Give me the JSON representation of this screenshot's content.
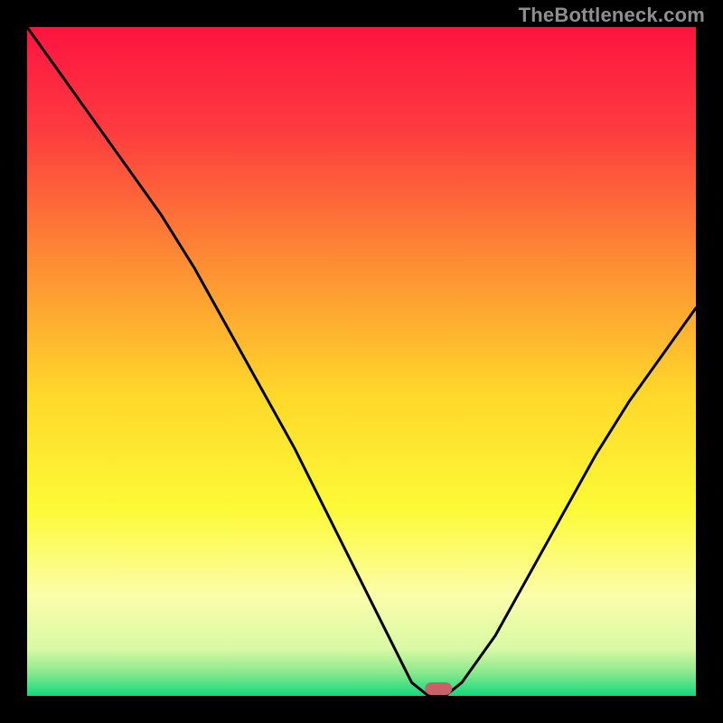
{
  "watermark": "TheBottleneck.com",
  "chart_data": {
    "type": "line",
    "title": "",
    "xlabel": "",
    "ylabel": "",
    "x": [
      0.0,
      0.05,
      0.1,
      0.15,
      0.2,
      0.25,
      0.3,
      0.35,
      0.4,
      0.45,
      0.5,
      0.55,
      0.575,
      0.6,
      0.625,
      0.65,
      0.7,
      0.75,
      0.8,
      0.85,
      0.9,
      0.95,
      1.0
    ],
    "values": [
      1.0,
      0.93,
      0.86,
      0.79,
      0.72,
      0.64,
      0.55,
      0.46,
      0.37,
      0.27,
      0.17,
      0.07,
      0.02,
      0.0,
      0.0,
      0.02,
      0.09,
      0.18,
      0.27,
      0.36,
      0.44,
      0.51,
      0.58
    ],
    "ylim": [
      0,
      1
    ],
    "xlim": [
      0,
      1
    ],
    "marker": {
      "x": 0.615,
      "width_frac": 0.04,
      "color": "#c96169"
    },
    "gradient_stops": [
      {
        "pos": 0.0,
        "color": "#fd1440"
      },
      {
        "pos": 0.15,
        "color": "#fd3a3f"
      },
      {
        "pos": 0.35,
        "color": "#fd8c34"
      },
      {
        "pos": 0.55,
        "color": "#fed82a"
      },
      {
        "pos": 0.72,
        "color": "#fcfa36"
      },
      {
        "pos": 0.85,
        "color": "#fbfdaa"
      },
      {
        "pos": 0.93,
        "color": "#d8f9a5"
      },
      {
        "pos": 0.965,
        "color": "#8ae98d"
      },
      {
        "pos": 1.0,
        "color": "#11d97c"
      }
    ]
  }
}
